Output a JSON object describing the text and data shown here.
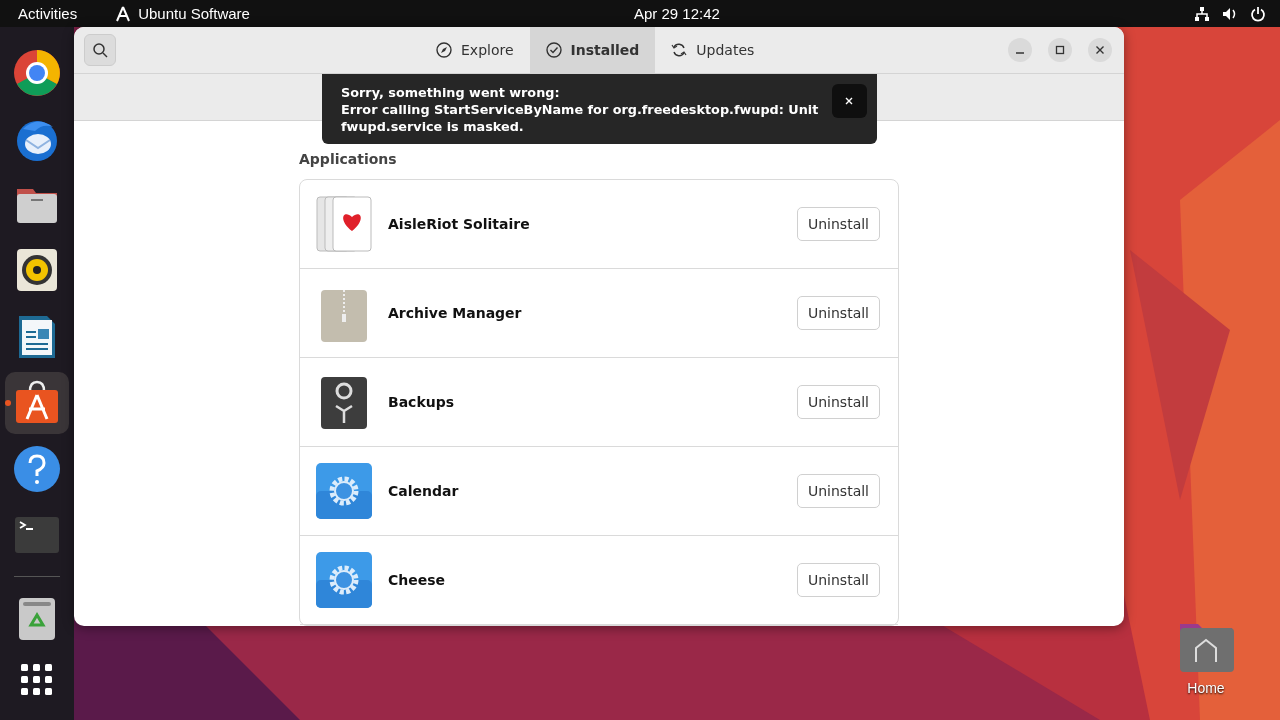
{
  "top_bar": {
    "activities": "Activities",
    "app_name": "Ubuntu Software",
    "clock": "Apr 29  12:42"
  },
  "dock": [
    {
      "selected": false
    },
    {
      "selected": false
    },
    {
      "selected": false
    },
    {
      "selected": false
    },
    {
      "selected": false
    },
    {
      "selected": true
    },
    {
      "selected": false
    },
    {
      "selected": false
    },
    {
      "selected": false
    },
    {
      "selected": false
    }
  ],
  "window": {
    "tabs": [
      {
        "label": "Explore",
        "selected": false
      },
      {
        "label": "Installed",
        "selected": true
      },
      {
        "label": "Updates",
        "selected": false
      }
    ],
    "notification": {
      "title": "Sorry, something went wrong:",
      "message": "Error calling StartServiceByName for org.freedesktop.fwupd: Unit fwupd.service is masked."
    },
    "section_title": "Applications",
    "apps": [
      {
        "name": "AisleRiot Solitaire",
        "button": "Uninstall"
      },
      {
        "name": "Archive Manager",
        "button": "Uninstall"
      },
      {
        "name": "Backups",
        "button": "Uninstall"
      },
      {
        "name": "Calendar",
        "button": "Uninstall"
      },
      {
        "name": "Cheese",
        "button": "Uninstall"
      }
    ]
  },
  "desktop_icons": [
    {
      "label": "Home"
    }
  ]
}
